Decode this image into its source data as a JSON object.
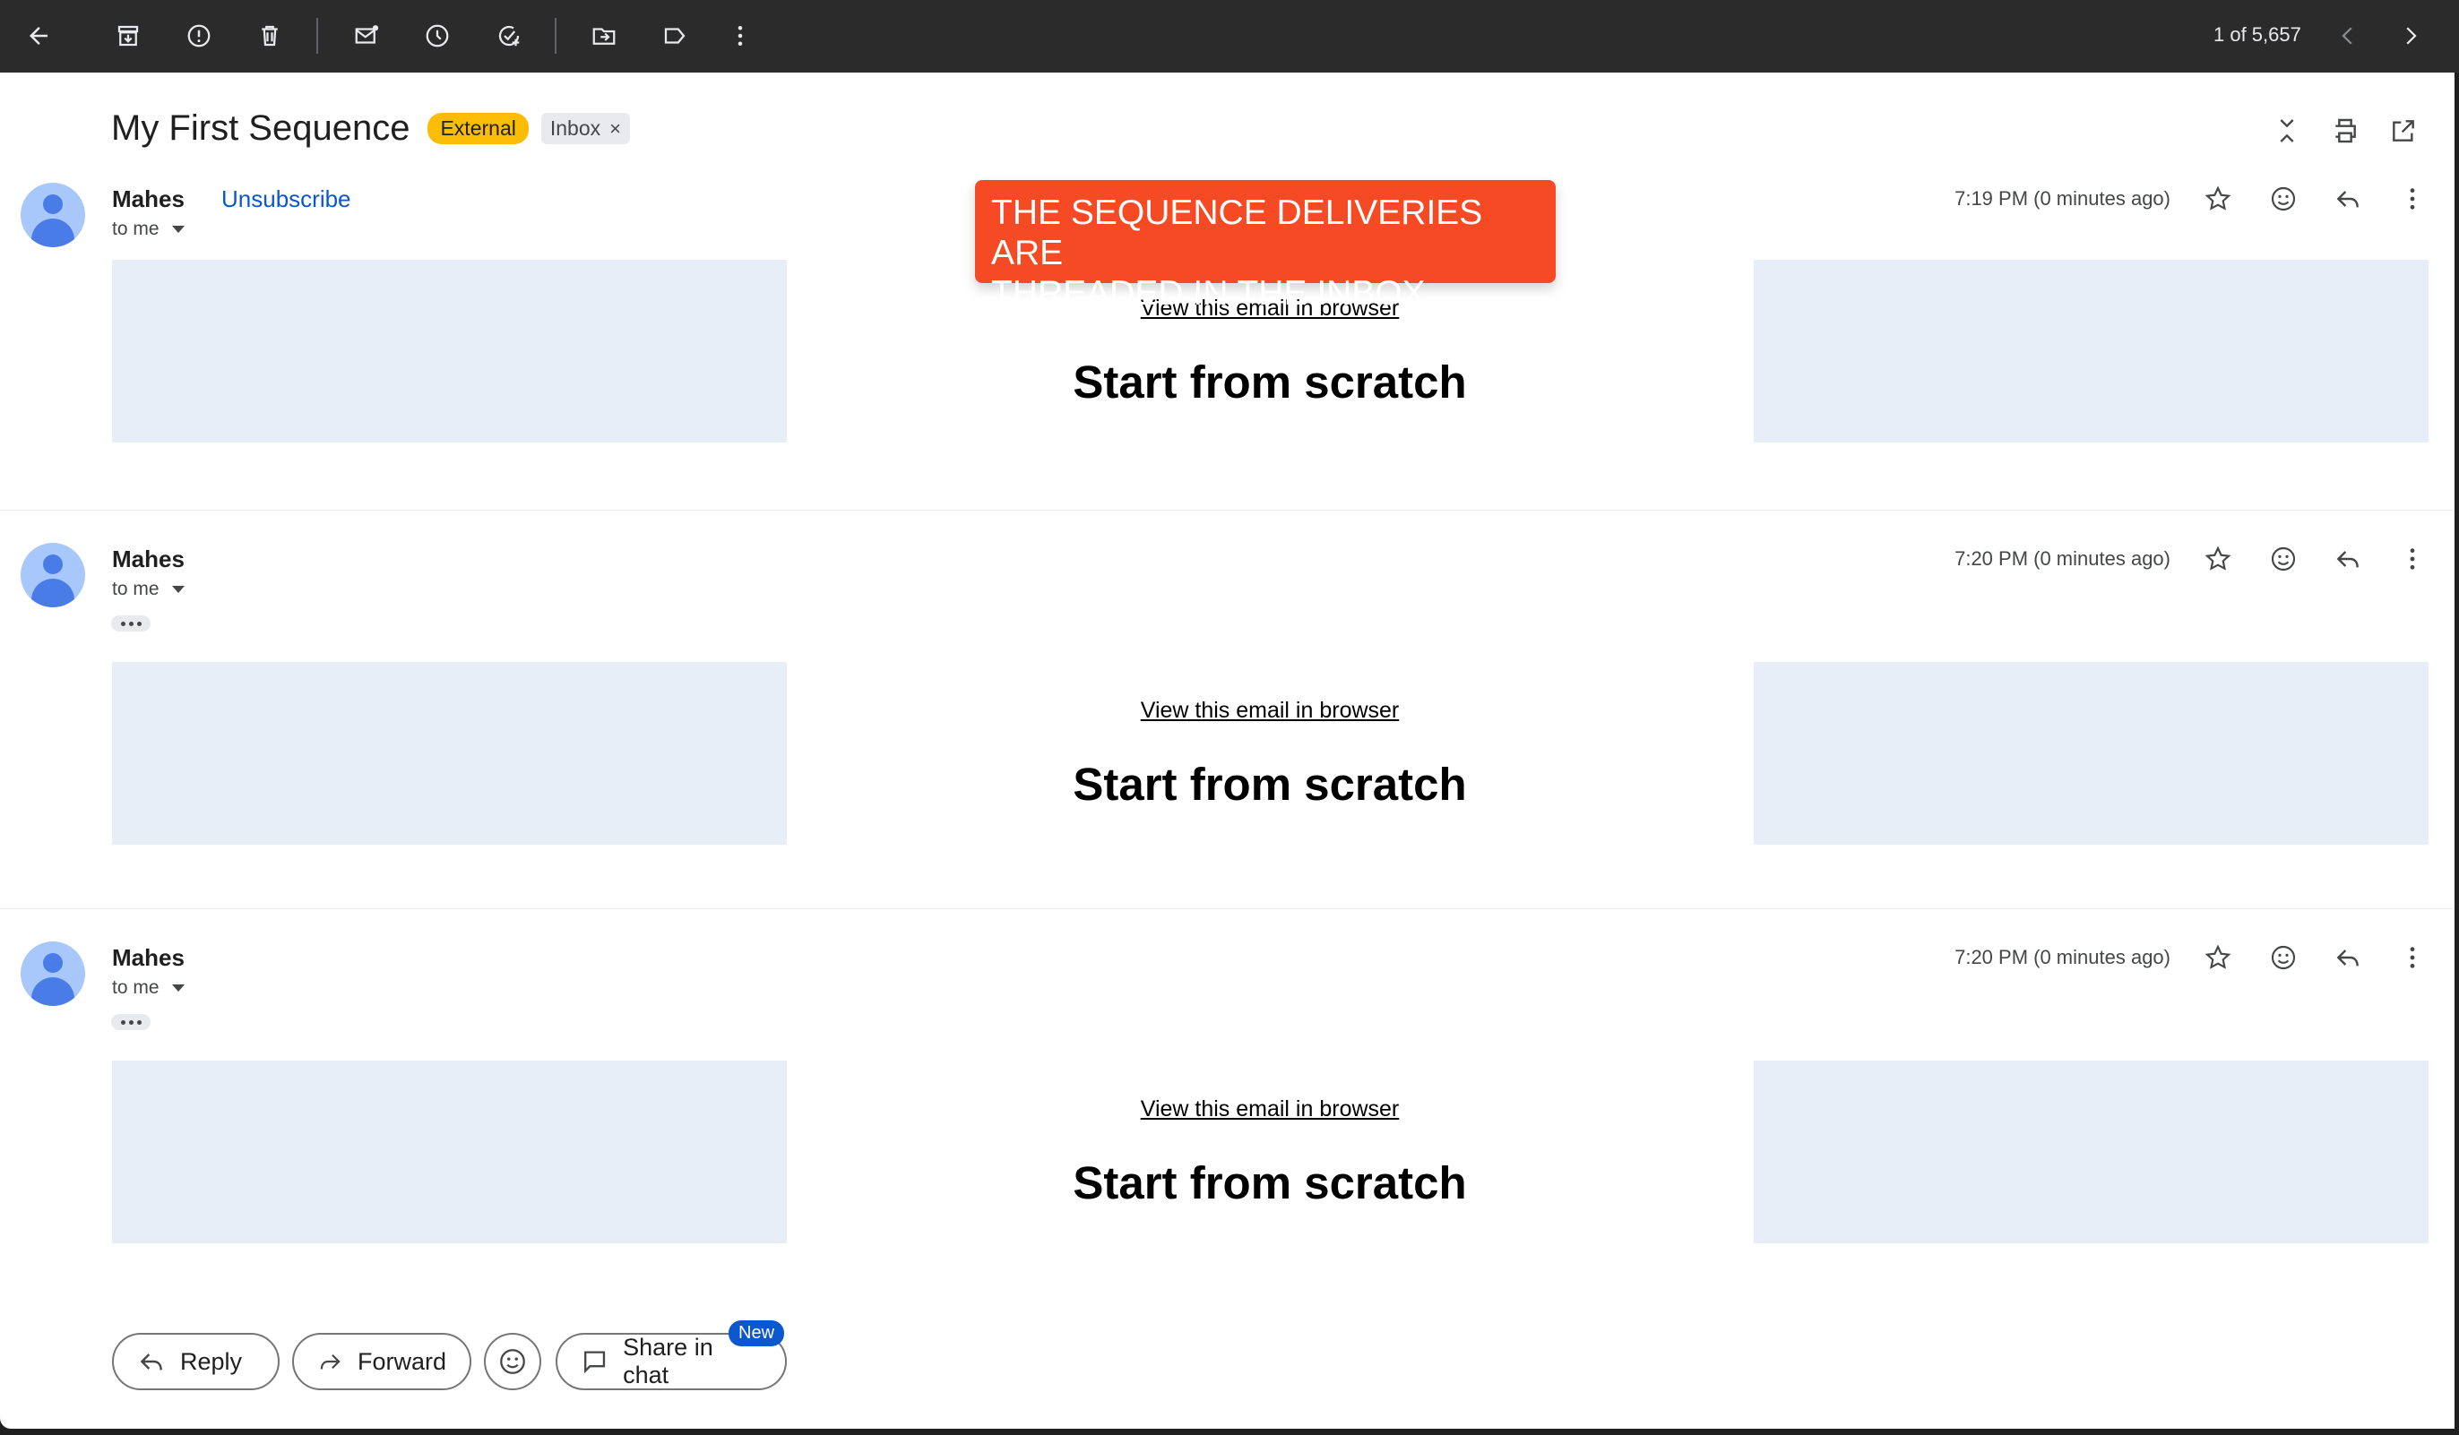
{
  "toolbar": {
    "page_count": "1 of 5,657",
    "icons": [
      "back-arrow-icon",
      "archive-icon",
      "report-spam-icon",
      "delete-icon",
      "mark-unread-icon",
      "snooze-icon",
      "add-to-tasks-icon",
      "move-to-icon",
      "label-icon",
      "more-vert-icon",
      "prev-icon",
      "next-icon"
    ]
  },
  "thread": {
    "subject": "My First Sequence",
    "labels": {
      "external": "External",
      "inbox": "Inbox",
      "remove": "×"
    }
  },
  "banner": {
    "line1": "THE SEQUENCE DELIVERIES ARE",
    "line2": "THREADED IN THE INBOX"
  },
  "messages": [
    {
      "sender": "Mahes",
      "unsubscribe": "Unsubscribe",
      "to": "to me",
      "time": "7:19 PM (0 minutes ago)",
      "view_link": "View this email in browser",
      "headline": "Start from scratch"
    },
    {
      "sender": "Mahes",
      "to": "to me",
      "time": "7:20 PM (0 minutes ago)",
      "view_link": "View this email in browser",
      "headline": "Start from scratch"
    },
    {
      "sender": "Mahes",
      "to": "to me",
      "time": "7:20 PM (0 minutes ago)",
      "view_link": "View this email in browser",
      "headline": "Start from scratch"
    }
  ],
  "actions": {
    "reply": "Reply",
    "forward": "Forward",
    "share_chat": "Share in chat",
    "new_badge": "New"
  },
  "colors": {
    "toolbar_bg": "#2b2b2b",
    "banner": "#f64a24",
    "external_chip": "#fbbc04",
    "link": "#0b57d0",
    "placeholder": "#e8eef7"
  }
}
